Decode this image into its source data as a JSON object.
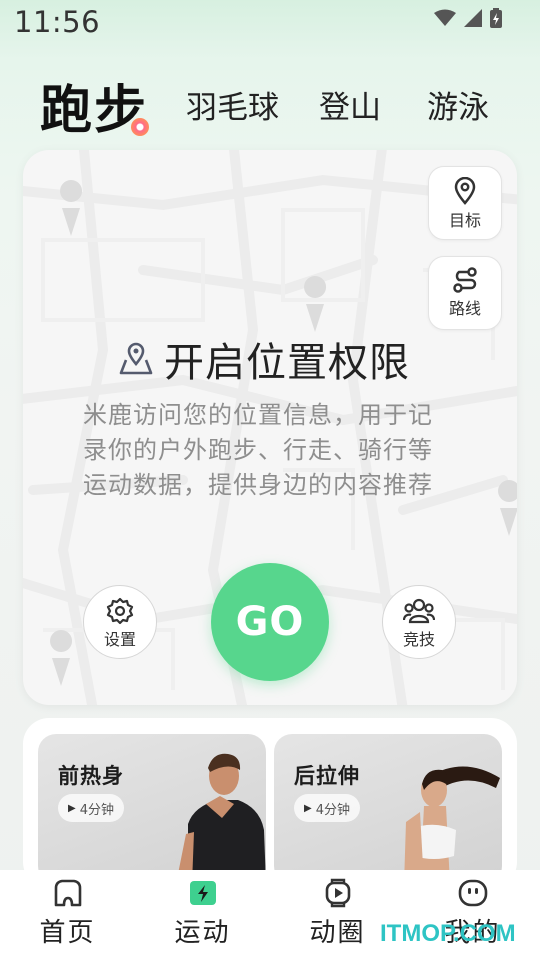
{
  "status_bar": {
    "time": "11:56",
    "icons": [
      "wifi-icon",
      "signal-icon",
      "battery-icon"
    ]
  },
  "sport_tabs": {
    "active": "跑步",
    "items": [
      "羽毛球",
      "登山",
      "游泳"
    ]
  },
  "map_card": {
    "side_buttons": {
      "target": "目标",
      "route": "路线"
    },
    "permission_title": "开启位置权限",
    "permission_desc": "米鹿访问您的位置信息，用于记录你的户外跑步、行走、骑行等运动数据，提供身边的内容推荐",
    "settings_label": "设置",
    "go_label": "GO",
    "compete_label": "竞技"
  },
  "courses": [
    {
      "title": "前热身",
      "duration": "4分钟"
    },
    {
      "title": "后拉伸",
      "duration": "4分钟"
    }
  ],
  "bottom_nav": [
    {
      "label": "首页",
      "icon": "home-icon"
    },
    {
      "label": "运动",
      "icon": "sport-icon",
      "active": true
    },
    {
      "label": "动圈",
      "icon": "moments-icon"
    },
    {
      "label": "我的",
      "icon": "profile-icon"
    }
  ],
  "watermark": "ITMOP.COM",
  "colors": {
    "accent": "#57d68d",
    "active_nav": "#3ed08f"
  }
}
